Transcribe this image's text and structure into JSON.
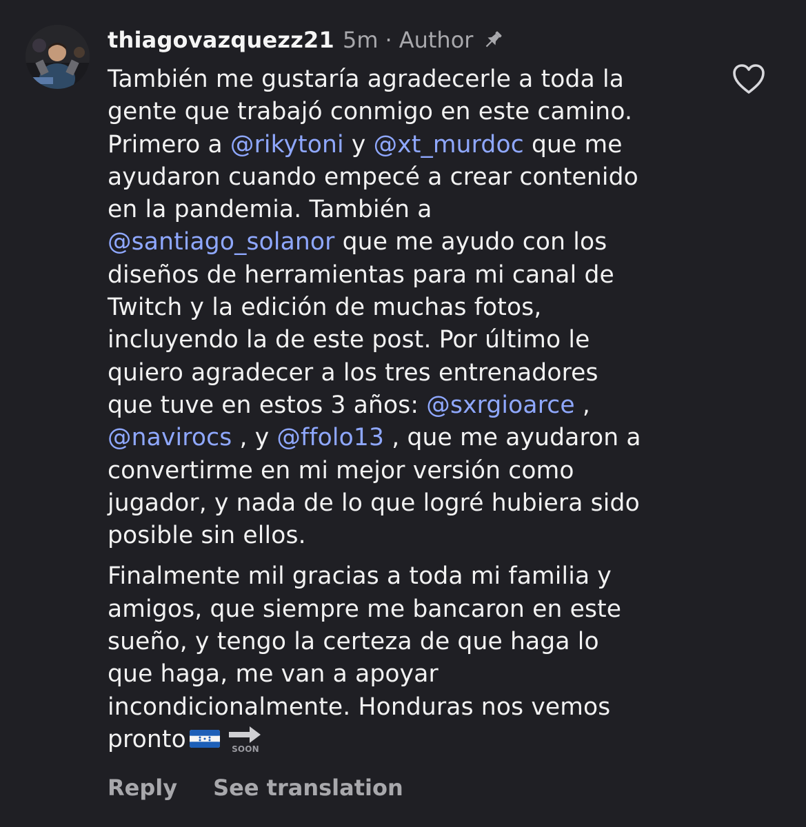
{
  "comment": {
    "username": "thiagovazquezz21",
    "time": "5m",
    "separator": "·",
    "author_label": "Author",
    "icons": {
      "avatar": "user-avatar-photo",
      "pin": "pin-icon",
      "like": "heart-outline-icon",
      "flag": "honduras-flag-emoji",
      "soon": "soon-arrow-emoji"
    },
    "colors": {
      "background": "#1f1f24",
      "text": "#f2f2f2",
      "muted": "#a8a8ac",
      "mention": "#8fa8ff"
    },
    "lines1": [
      [
        {
          "t": "También me gustaría agradecerle a toda la"
        }
      ],
      [
        {
          "t": "gente que trabajó conmigo en este camino."
        }
      ],
      [
        {
          "t": "Primero a "
        },
        {
          "t": "@rikytoni",
          "m": true
        },
        {
          "t": " y "
        },
        {
          "t": "@xt_murdoc",
          "m": true
        },
        {
          "t": " que me"
        }
      ],
      [
        {
          "t": "ayudaron cuando empecé a crear contenido"
        }
      ],
      [
        {
          "t": "en la pandemia. También a"
        }
      ],
      [
        {
          "t": "@santiago_solanor",
          "m": true
        },
        {
          "t": " que me ayudo con los"
        }
      ],
      [
        {
          "t": "diseños de herramientas para mi canal de"
        }
      ],
      [
        {
          "t": "Twitch y la edición de muchas fotos,"
        }
      ],
      [
        {
          "t": "incluyendo la de este post.  Por último le"
        }
      ],
      [
        {
          "t": "quiero agradecer a los tres entrenadores"
        }
      ],
      [
        {
          "t": "que tuve en estos 3 años: "
        },
        {
          "t": "@sxrgioarce",
          "m": true
        },
        {
          "t": " ,"
        }
      ],
      [
        {
          "t": "@navirocs",
          "m": true
        },
        {
          "t": " , y "
        },
        {
          "t": "@ffolo13",
          "m": true
        },
        {
          "t": " , que me ayudaron a"
        }
      ],
      [
        {
          "t": "convertirme en mi mejor versión como"
        }
      ],
      [
        {
          "t": "jugador, y nada de lo que logré hubiera sido"
        }
      ],
      [
        {
          "t": "posible sin ellos."
        }
      ]
    ],
    "lines2": [
      [
        {
          "t": "Finalmente mil gracias a toda mi familia y"
        }
      ],
      [
        {
          "t": "amigos, que siempre me bancaron en este"
        }
      ],
      [
        {
          "t": "sueño, y tengo la certeza de que haga lo"
        }
      ],
      [
        {
          "t": "que haga, me van a apoyar"
        }
      ],
      [
        {
          "t": "incondicionalmente. Honduras nos vemos"
        }
      ],
      [
        {
          "t": "pronto"
        },
        {
          "emoji": "flag"
        },
        {
          "emoji": "soon"
        }
      ]
    ],
    "soon_label": "SOON",
    "actions": {
      "reply": "Reply",
      "see_translation": "See translation"
    }
  }
}
